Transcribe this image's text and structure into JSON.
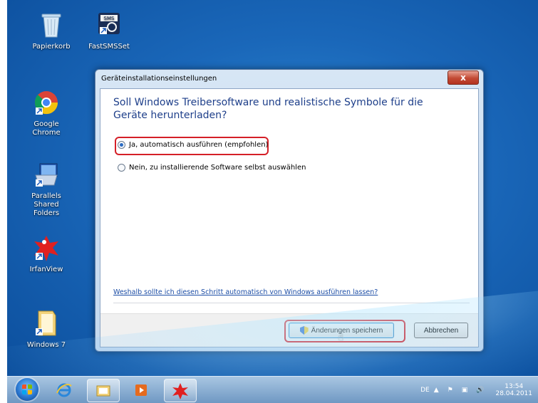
{
  "desktop": {
    "icons": [
      {
        "label": "Papierkorb"
      },
      {
        "label": "FastSMSSet"
      },
      {
        "label": "Google Chrome"
      },
      {
        "label": "Parallels Shared Folders"
      },
      {
        "label": "IrfanView"
      },
      {
        "label": "Windows 7"
      }
    ]
  },
  "dialog": {
    "title": "Geräteinstallationseinstellungen",
    "heading": "Soll Windows Treibersoftware und realistische Symbole für die Geräte herunterladen?",
    "options": [
      {
        "label": "Ja, automatisch ausführen (empfohlen)",
        "selected": true
      },
      {
        "label": "Nein, zu installierende Software selbst auswählen",
        "selected": false
      }
    ],
    "link": "Weshalb sollte ich diesen Schritt automatisch von Windows ausführen lassen?",
    "buttons": {
      "save": "Änderungen speichern",
      "cancel": "Abbrechen"
    },
    "close_symbol": "x"
  },
  "taskbar": {
    "language": "DE",
    "time": "13:54",
    "date": "28.04.2011"
  },
  "colors": {
    "highlight": "#d51f27",
    "heading": "#1e3f8a",
    "link": "#1d4ea6"
  }
}
